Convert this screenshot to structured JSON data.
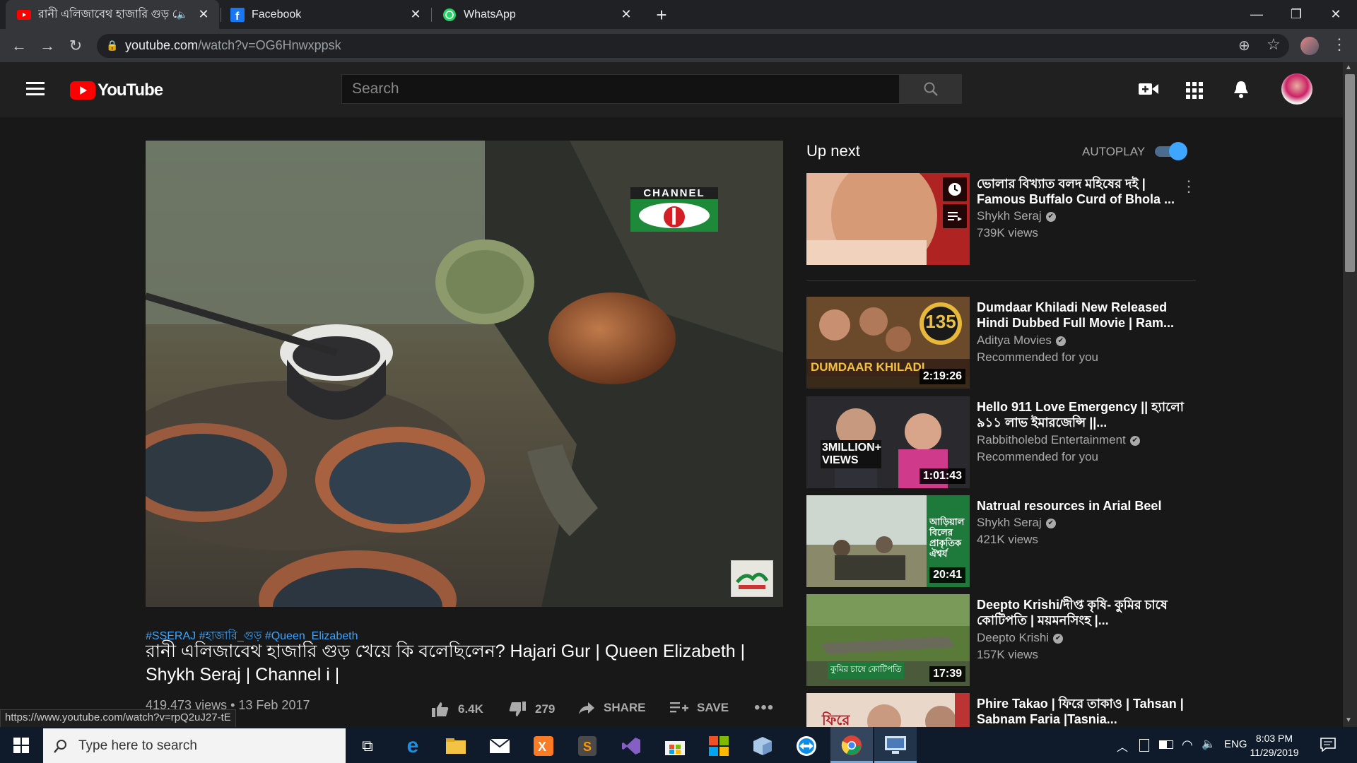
{
  "browser": {
    "tabs": [
      {
        "title": "রানী এলিজাবেথ হাজারি গুড় কে",
        "icon": "youtube-icon"
      },
      {
        "title": "Facebook",
        "icon": "facebook-icon"
      },
      {
        "title": "WhatsApp",
        "icon": "whatsapp-icon"
      }
    ],
    "url_host": "youtube.com",
    "url_path": "/watch?v=OG6Hnwxppsk",
    "status_link": "https://www.youtube.com/watch?v=rpQ2uJ27-tE"
  },
  "youtube": {
    "logo_text": "YouTube",
    "search_placeholder": "Search",
    "up_next_label": "Up next",
    "autoplay_label": "AUTOPLAY",
    "autoplay_on": true
  },
  "video": {
    "hashtags": "#SSERAJ #হাজারি_গুড় #Queen_Elizabeth",
    "title": "রানী এলিজাবেথ হাজারি গুড় খেয়ে কি বলেছিলেন? Hajari Gur | Queen Elizabeth | Shykh Seraj | Channel i |",
    "views": "419,473 views",
    "date": "13 Feb 2017",
    "likes": "6.4K",
    "dislikes": "279",
    "share_label": "SHARE",
    "save_label": "SAVE",
    "channel_logo_text": "CHANNEL"
  },
  "up_next": [
    {
      "title": "ভোলার বিখ্যাত বলদ মহিষের দই | Famous Buffalo Curd of Bhola ...",
      "channel": "Shykh Seraj",
      "meta": "739K views",
      "duration": ""
    },
    {
      "title": "Dumdaar Khiladi New Released Hindi Dubbed Full Movie | Ram...",
      "channel": "Aditya Movies",
      "meta": "Recommended for you",
      "duration": "2:19:26"
    },
    {
      "title": "Hello 911 Love Emergency || হ্যালো ৯১১ লাভ ইমারজেন্সি ||...",
      "channel": "Rabbitholebd Entertainment",
      "meta": "Recommended for you",
      "duration": "1:01:43"
    },
    {
      "title": "Natrual resources in Arial Beel",
      "channel": "Shykh Seraj",
      "meta": "421K views",
      "duration": "20:41"
    },
    {
      "title": "Deepto Krishi/দীপ্ত কৃষি- কুমির চাষে কোটিপতি | ময়মনসিংহ |...",
      "channel": "Deepto Krishi",
      "meta": "157K views",
      "duration": "17:39"
    },
    {
      "title": "Phire Takao | ফিরে তাকাও | Tahsan | Sabnam Faria |Tasnia...",
      "channel": "",
      "meta": "",
      "duration": ""
    }
  ],
  "thumb_text": {
    "dumdaar_badge": "135",
    "dumdaar_title": "DUMDAAR KHILADI",
    "hello_badge": "3MILLION+ VIEWS",
    "beel_text": "আড়িয়াল বিলের প্রাকৃতিক ঐশ্বর্য",
    "croc_text": "কুমির চাষে কোটিপতি",
    "phire_text": "ফিরে"
  },
  "taskbar": {
    "search_placeholder": "Type here to search",
    "language": "ENG",
    "time": "8:03 PM",
    "date": "11/29/2019"
  },
  "colors": {
    "youtube_red": "#ff0000",
    "link_blue": "#3ea6ff",
    "autoplay_blue": "#3ea6ff"
  }
}
